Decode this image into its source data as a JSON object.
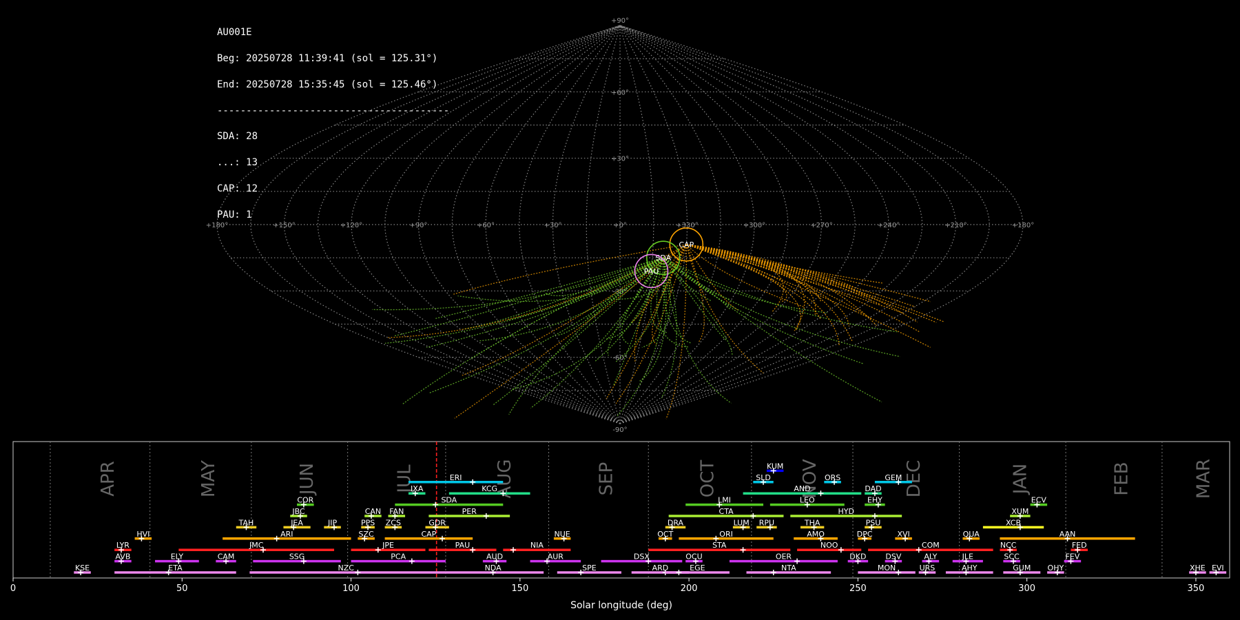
{
  "info": {
    "station": "AU001E",
    "beg": "Beg: 20250728 11:39:41 (sol = 125.31°)",
    "end": "End: 20250728 15:35:45 (sol = 125.46°)",
    "separator": "----------------------------------------",
    "counts": [
      "SDA: 28",
      "...: 13",
      "CAP: 12",
      "PAU: 1"
    ]
  },
  "sky": {
    "lon_labels": [
      "+180°",
      "+150°",
      "+120°",
      "+90°",
      "+60°",
      "+30°",
      "+0°",
      "+330°",
      "+300°",
      "+270°",
      "+240°",
      "+210°",
      "+180°"
    ],
    "lat_labels": [
      "+90°",
      "+60°",
      "+30°",
      "-30°",
      "-60°",
      "-90°"
    ],
    "radiants": [
      {
        "code": "CAP",
        "lon": 330,
        "lat": -9,
        "color": "#ffa500"
      },
      {
        "code": "SDA",
        "lon": 340,
        "lat": -15,
        "color": "#66cc22"
      },
      {
        "code": "PAU",
        "lon": 345,
        "lat": -21,
        "color": "#ee82ee"
      }
    ],
    "colors": {
      "sda": "#6abf2a",
      "cap": "#e69500",
      "grid": "#888888"
    }
  },
  "chart_data": {
    "type": "timeline",
    "xlabel": "Solar longitude (deg)",
    "xlim": [
      0,
      360
    ],
    "xticks": [
      0,
      50,
      100,
      150,
      200,
      250,
      300,
      350
    ],
    "current_sol": 125.3,
    "months": [
      {
        "label": "APR",
        "start": 11.0
      },
      {
        "label": "MAY",
        "start": 40.5
      },
      {
        "label": "JUN",
        "start": 70.5
      },
      {
        "label": "JUL",
        "start": 99.0
      },
      {
        "label": "AUG",
        "start": 128.0
      },
      {
        "label": "SEP",
        "start": 158.5
      },
      {
        "label": "OCT",
        "start": 188.0
      },
      {
        "label": "NOV",
        "start": 218.5
      },
      {
        "label": "DEC",
        "start": 248.5
      },
      {
        "label": "JAN",
        "start": 280.0
      },
      {
        "label": "FEB",
        "start": 311.5
      },
      {
        "label": "MAR",
        "start": 340.0
      }
    ],
    "showers": [
      {
        "code": "KUM",
        "start": 223,
        "end": 228,
        "peak": 225,
        "row": 9,
        "color": "#0000ff"
      },
      {
        "code": "ERI",
        "start": 117,
        "end": 145,
        "peak": 136,
        "row": 8,
        "color": "#00c8e8"
      },
      {
        "code": "SLD",
        "start": 219,
        "end": 225,
        "peak": 222,
        "row": 8,
        "color": "#00c8e8"
      },
      {
        "code": "ORS",
        "start": 240,
        "end": 245,
        "peak": 243,
        "row": 8,
        "color": "#00c8e8"
      },
      {
        "code": "GEM",
        "start": 255,
        "end": 266,
        "peak": 262,
        "row": 8,
        "color": "#00c8e8"
      },
      {
        "code": "IXA",
        "start": 117,
        "end": 122,
        "peak": 119,
        "row": 7,
        "color": "#22dd88"
      },
      {
        "code": "KCG",
        "start": 129,
        "end": 153,
        "peak": 145,
        "row": 7,
        "color": "#22dd88"
      },
      {
        "code": "AND",
        "start": 216,
        "end": 251,
        "peak": 239,
        "row": 7,
        "color": "#22dd88"
      },
      {
        "code": "DAD",
        "start": 252,
        "end": 257,
        "peak": 255,
        "row": 7,
        "color": "#22dd88"
      },
      {
        "code": "COR",
        "start": 84,
        "end": 89,
        "peak": 86,
        "row": 6,
        "color": "#55cc22"
      },
      {
        "code": "SDA",
        "start": 113,
        "end": 145,
        "peak": 125,
        "row": 6,
        "color": "#55cc22"
      },
      {
        "code": "LMI",
        "start": 199,
        "end": 222,
        "peak": 209,
        "row": 6,
        "color": "#55cc22"
      },
      {
        "code": "LEO",
        "start": 224,
        "end": 246,
        "peak": 235,
        "row": 6,
        "color": "#55cc22"
      },
      {
        "code": "EHY",
        "start": 252,
        "end": 258,
        "peak": 256,
        "row": 6,
        "color": "#55cc22"
      },
      {
        "code": "ECV",
        "start": 301,
        "end": 306,
        "peak": 303,
        "row": 6,
        "color": "#55cc22"
      },
      {
        "code": "JBC",
        "start": 82,
        "end": 87,
        "peak": 85,
        "row": 5,
        "color": "#aaee33"
      },
      {
        "code": "CAN",
        "start": 104,
        "end": 109,
        "peak": 106,
        "row": 5,
        "color": "#aaee33"
      },
      {
        "code": "FAN",
        "start": 111,
        "end": 116,
        "peak": 113,
        "row": 5,
        "color": "#aaee33"
      },
      {
        "code": "PER",
        "start": 123,
        "end": 147,
        "peak": 140,
        "row": 5,
        "color": "#aaee33"
      },
      {
        "code": "CTA",
        "start": 194,
        "end": 228,
        "peak": 219,
        "row": 5,
        "color": "#aaee33"
      },
      {
        "code": "HYD",
        "start": 230,
        "end": 263,
        "peak": 255,
        "row": 5,
        "color": "#aaee33"
      },
      {
        "code": "XUM",
        "start": 295,
        "end": 301,
        "peak": 298,
        "row": 5,
        "color": "#aaee33"
      },
      {
        "code": "TAH",
        "start": 66,
        "end": 72,
        "peak": 69,
        "row": 4,
        "color": "#eecc22"
      },
      {
        "code": "JEA",
        "start": 80,
        "end": 88,
        "peak": 83,
        "row": 4,
        "color": "#eecc22"
      },
      {
        "code": "JIP",
        "start": 92,
        "end": 97,
        "peak": 95,
        "row": 4,
        "color": "#eecc22"
      },
      {
        "code": "PPS",
        "start": 103,
        "end": 107,
        "peak": 105,
        "row": 4,
        "color": "#eecc22"
      },
      {
        "code": "ZCS",
        "start": 110,
        "end": 115,
        "peak": 113,
        "row": 4,
        "color": "#eecc22"
      },
      {
        "code": "GDR",
        "start": 122,
        "end": 129,
        "peak": 125,
        "row": 4,
        "color": "#eecc22"
      },
      {
        "code": "DRA",
        "start": 193,
        "end": 199,
        "peak": 195,
        "row": 4,
        "color": "#eecc22"
      },
      {
        "code": "LUM",
        "start": 213,
        "end": 218,
        "peak": 216,
        "row": 4,
        "color": "#eecc22"
      },
      {
        "code": "RPU",
        "start": 220,
        "end": 226,
        "peak": 224,
        "row": 4,
        "color": "#eecc22"
      },
      {
        "code": "THA",
        "start": 233,
        "end": 240,
        "peak": 237,
        "row": 4,
        "color": "#eecc22"
      },
      {
        "code": "PSU",
        "start": 252,
        "end": 257,
        "peak": 254,
        "row": 4,
        "color": "#eecc22"
      },
      {
        "code": "XCB",
        "start": 287,
        "end": 305,
        "peak": 298,
        "row": 4,
        "color": "#ffff22"
      },
      {
        "code": "HVI",
        "start": 36,
        "end": 41,
        "peak": 38,
        "row": 3,
        "color": "#ffa500"
      },
      {
        "code": "ARI",
        "start": 62,
        "end": 100,
        "peak": 78,
        "row": 3,
        "color": "#ffa500"
      },
      {
        "code": "SZC",
        "start": 102,
        "end": 107,
        "peak": 104,
        "row": 3,
        "color": "#ffa500"
      },
      {
        "code": "CAP",
        "start": 110,
        "end": 136,
        "peak": 127,
        "row": 3,
        "color": "#ffa500"
      },
      {
        "code": "NUE",
        "start": 160,
        "end": 165,
        "peak": 163,
        "row": 3,
        "color": "#ffa500"
      },
      {
        "code": "OCT",
        "start": 191,
        "end": 195,
        "peak": 193,
        "row": 3,
        "color": "#ffa500"
      },
      {
        "code": "ORI",
        "start": 197,
        "end": 225,
        "peak": 208,
        "row": 3,
        "color": "#ffa500"
      },
      {
        "code": "AMO",
        "start": 231,
        "end": 244,
        "peak": 239,
        "row": 3,
        "color": "#ffa500"
      },
      {
        "code": "DPC",
        "start": 250,
        "end": 254,
        "peak": 252,
        "row": 3,
        "color": "#ffa500"
      },
      {
        "code": "XVI",
        "start": 261,
        "end": 266,
        "peak": 264,
        "row": 3,
        "color": "#ffa500"
      },
      {
        "code": "QUA",
        "start": 281,
        "end": 286,
        "peak": 283,
        "row": 3,
        "color": "#ffa500"
      },
      {
        "code": "AAN",
        "start": 292,
        "end": 332,
        "peak": 312,
        "row": 3,
        "color": "#ffa500"
      },
      {
        "code": "LYR",
        "start": 30,
        "end": 35,
        "peak": 32,
        "row": 2,
        "color": "#ff2020"
      },
      {
        "code": "JMC",
        "start": 49,
        "end": 95,
        "peak": 74,
        "row": 2,
        "color": "#ff2020"
      },
      {
        "code": "JPE",
        "start": 100,
        "end": 122,
        "peak": 108,
        "row": 2,
        "color": "#ff2020"
      },
      {
        "code": "PAU",
        "start": 123,
        "end": 143,
        "peak": 136,
        "row": 2,
        "color": "#ff2020"
      },
      {
        "code": "NIA",
        "start": 145,
        "end": 165,
        "peak": 148,
        "row": 2,
        "color": "#ff2020"
      },
      {
        "code": "STA",
        "start": 188,
        "end": 230,
        "peak": 216,
        "row": 2,
        "color": "#ff2020"
      },
      {
        "code": "NOO",
        "start": 232,
        "end": 251,
        "peak": 245,
        "row": 2,
        "color": "#ff2020"
      },
      {
        "code": "COM",
        "start": 253,
        "end": 290,
        "peak": 268,
        "row": 2,
        "color": "#ff2020"
      },
      {
        "code": "NCC",
        "start": 292,
        "end": 297,
        "peak": 295,
        "row": 2,
        "color": "#ff2020"
      },
      {
        "code": "FED",
        "start": 313,
        "end": 318,
        "peak": 315,
        "row": 2,
        "color": "#ff2020"
      },
      {
        "code": "AVB",
        "start": 30,
        "end": 35,
        "peak": 32,
        "row": 1,
        "color": "#cc33ee"
      },
      {
        "code": "ELY",
        "start": 42,
        "end": 55,
        "peak": 49,
        "row": 1,
        "color": "#cc33ee"
      },
      {
        "code": "CAM",
        "start": 60,
        "end": 66,
        "peak": 63,
        "row": 1,
        "color": "#cc33ee"
      },
      {
        "code": "SSG",
        "start": 71,
        "end": 97,
        "peak": 86,
        "row": 1,
        "color": "#cc33ee"
      },
      {
        "code": "PCA",
        "start": 100,
        "end": 128,
        "peak": 118,
        "row": 1,
        "color": "#cc33ee"
      },
      {
        "code": "AUD",
        "start": 139,
        "end": 146,
        "peak": 143,
        "row": 1,
        "color": "#cc33ee"
      },
      {
        "code": "AUR",
        "start": 153,
        "end": 168,
        "peak": 158,
        "row": 1,
        "color": "#cc33ee"
      },
      {
        "code": "DSX",
        "start": 174,
        "end": 198,
        "peak": 188,
        "row": 1,
        "color": "#cc33ee"
      },
      {
        "code": "OCU",
        "start": 199,
        "end": 204,
        "peak": 202,
        "row": 1,
        "color": "#cc33ee"
      },
      {
        "code": "OER",
        "start": 212,
        "end": 244,
        "peak": 232,
        "row": 1,
        "color": "#cc33ee"
      },
      {
        "code": "DKD",
        "start": 247,
        "end": 253,
        "peak": 250,
        "row": 1,
        "color": "#cc33ee"
      },
      {
        "code": "DSV",
        "start": 258,
        "end": 263,
        "peak": 261,
        "row": 1,
        "color": "#cc33ee"
      },
      {
        "code": "ALY",
        "start": 269,
        "end": 274,
        "peak": 271,
        "row": 1,
        "color": "#cc33ee"
      },
      {
        "code": "JLE",
        "start": 278,
        "end": 287,
        "peak": 282,
        "row": 1,
        "color": "#cc33ee"
      },
      {
        "code": "SCC",
        "start": 293,
        "end": 298,
        "peak": 296,
        "row": 1,
        "color": "#cc33ee"
      },
      {
        "code": "FEV",
        "start": 311,
        "end": 316,
        "peak": 313,
        "row": 1,
        "color": "#cc33ee"
      },
      {
        "code": "KSE",
        "start": 18,
        "end": 23,
        "peak": 20,
        "row": 0,
        "color": "#ee88ee"
      },
      {
        "code": "ETA",
        "start": 30,
        "end": 66,
        "peak": 46,
        "row": 0,
        "color": "#ee88ee"
      },
      {
        "code": "NZC",
        "start": 70,
        "end": 127,
        "peak": 102,
        "row": 0,
        "color": "#ee88ee"
      },
      {
        "code": "NDA",
        "start": 127,
        "end": 157,
        "peak": 142,
        "row": 0,
        "color": "#ee88ee"
      },
      {
        "code": "SPE",
        "start": 161,
        "end": 180,
        "peak": 168,
        "row": 0,
        "color": "#ee88ee"
      },
      {
        "code": "ARD",
        "start": 183,
        "end": 200,
        "peak": 193,
        "row": 0,
        "color": "#ee88ee"
      },
      {
        "code": "EGE",
        "start": 193,
        "end": 212,
        "peak": 197,
        "row": 0,
        "color": "#ee88ee"
      },
      {
        "code": "NTA",
        "start": 217,
        "end": 242,
        "peak": 225,
        "row": 0,
        "color": "#ee88ee"
      },
      {
        "code": "MON",
        "start": 250,
        "end": 267,
        "peak": 262,
        "row": 0,
        "color": "#ee88ee"
      },
      {
        "code": "URS",
        "start": 268,
        "end": 273,
        "peak": 270,
        "row": 0,
        "color": "#ee88ee"
      },
      {
        "code": "AHY",
        "start": 276,
        "end": 290,
        "peak": 282,
        "row": 0,
        "color": "#ee88ee"
      },
      {
        "code": "GUM",
        "start": 293,
        "end": 304,
        "peak": 298,
        "row": 0,
        "color": "#ee88ee"
      },
      {
        "code": "OHY",
        "start": 306,
        "end": 311,
        "peak": 309,
        "row": 0,
        "color": "#ee88ee"
      },
      {
        "code": "XHE",
        "start": 348,
        "end": 353,
        "peak": 350,
        "row": 0,
        "color": "#ee88ee"
      },
      {
        "code": "EVI",
        "start": 354,
        "end": 359,
        "peak": 356,
        "row": 0,
        "color": "#ee88ee"
      }
    ]
  }
}
